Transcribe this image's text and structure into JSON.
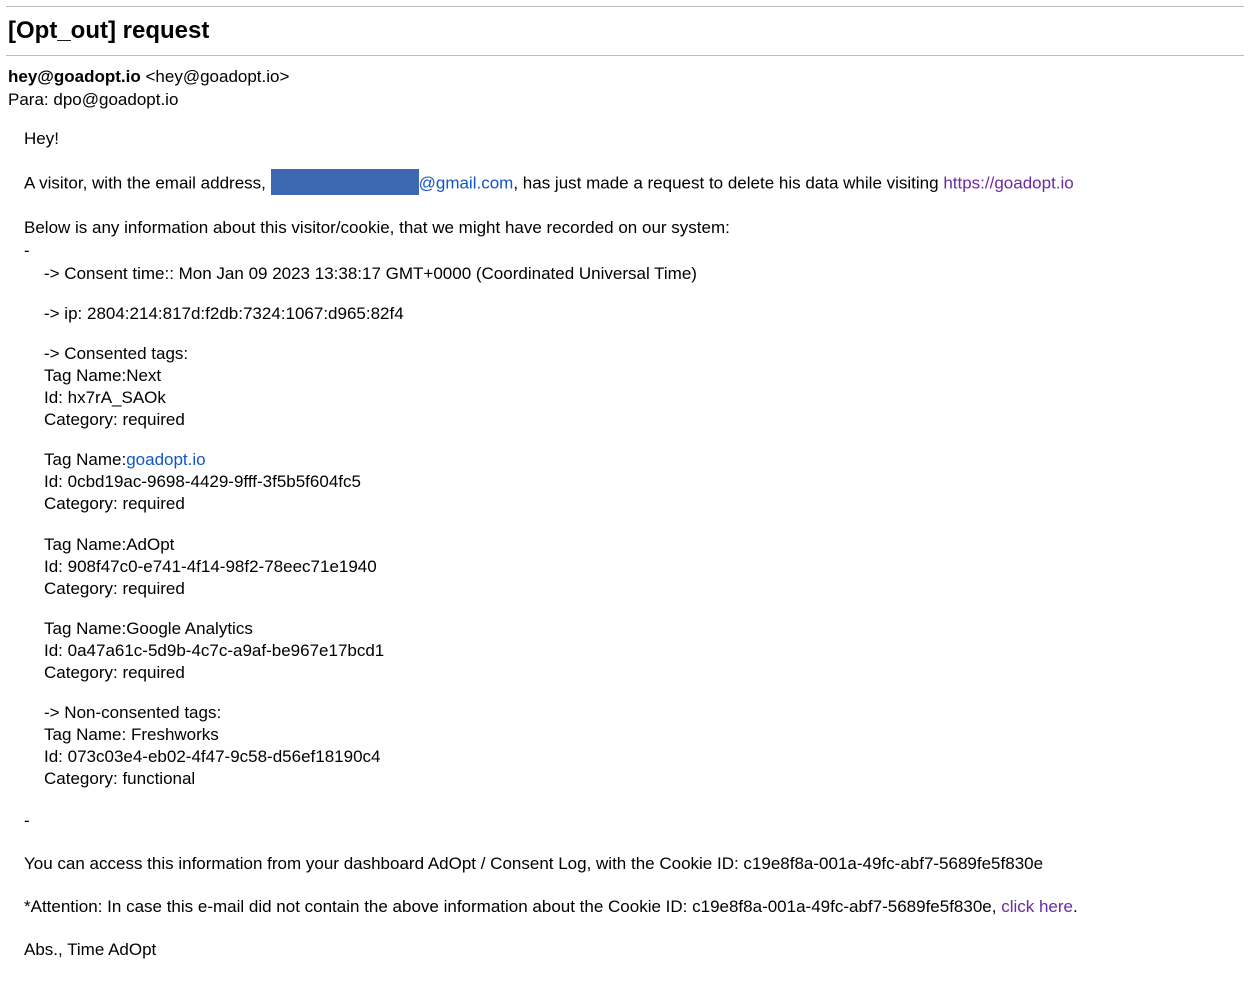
{
  "subject": "[Opt_out] request",
  "from": {
    "name": "hey@goadopt.io",
    "address": "<hey@goadopt.io>"
  },
  "to": {
    "label": "Para:",
    "address": "dpo@goadopt.io"
  },
  "greeting": "Hey!",
  "visitor_line": {
    "prefix": "A visitor, with the email address, ",
    "email_suffix": "@gmail.com",
    "mid": ", has just made a request to delete his data while visiting ",
    "site_url": "https://goadopt.io"
  },
  "below_line": "Below is any information about this visitor/cookie, that we might have recorded on our system:",
  "dash": "-",
  "consent_time": "-> Consent time:: Mon Jan 09 2023 13:38:17 GMT+0000 (Coordinated Universal Time)",
  "ip_line": "-> ip: 2804:214:817d:f2db:7324:1067:d965:82f4",
  "consented_header": "-> Consented tags:",
  "tags": [
    {
      "name_prefix": "Tag Name:",
      "name": "Next",
      "id_prefix": "Id: ",
      "id": "hx7rA_SAOk",
      "cat_prefix": "Category: ",
      "cat": "required",
      "link": false
    },
    {
      "name_prefix": "Tag Name:",
      "name": "goadopt.io",
      "id_prefix": "Id: ",
      "id": "0cbd19ac-9698-4429-9fff-3f5b5f604fc5",
      "cat_prefix": "Category: ",
      "cat": "required",
      "link": true
    },
    {
      "name_prefix": "Tag Name:",
      "name": "AdOpt",
      "id_prefix": "Id: ",
      "id": "908f47c0-e741-4f14-98f2-78eec71e1940",
      "cat_prefix": "Category: ",
      "cat": "required",
      "link": false
    },
    {
      "name_prefix": "Tag Name:",
      "name": "Google Analytics",
      "id_prefix": "Id: ",
      "id": "0a47a61c-5d9b-4c7c-a9af-be967e17bcd1",
      "cat_prefix": "Category: ",
      "cat": "required",
      "link": false
    }
  ],
  "nonconsented_header": "-> Non-consented tags:",
  "nc_tag": {
    "name_prefix": "Tag Name: ",
    "name": "Freshworks",
    "id_prefix": "Id: ",
    "id": "073c03e4-eb02-4f47-9c58-d56ef18190c4",
    "cat_prefix": "Category: ",
    "cat": "functional"
  },
  "dashboard_line": "You can access this information from your dashboard AdOpt / Consent Log, with the Cookie ID: c19e8f8a-001a-49fc-abf7-5689fe5f830e",
  "attention_line": {
    "prefix": "*Attention: In case this e-mail did not contain the above information about the Cookie ID: c19e8f8a-001a-49fc-abf7-5689fe5f830e, ",
    "link": "click here",
    "suffix": "."
  },
  "signoff": "Abs., Time AdOpt"
}
